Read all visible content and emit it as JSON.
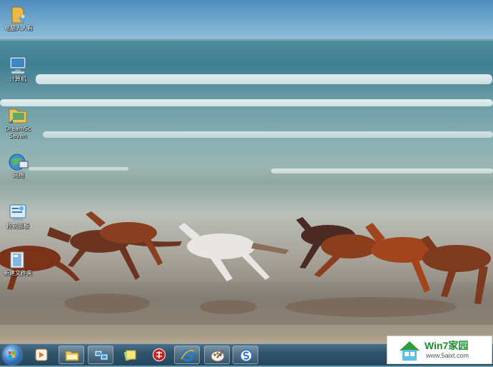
{
  "desktop": {
    "icons": [
      {
        "label": "电脑人人有",
        "icon": "user-folder-icon"
      },
      {
        "label": "计算机",
        "icon": "computer-icon"
      },
      {
        "label": "DreamSc\nSeven",
        "icon": "dreamscene-folder-icon"
      },
      {
        "label": "网络",
        "icon": "network-icon"
      },
      {
        "label": "控制面板",
        "icon": "control-panel-icon"
      },
      {
        "label": "新建文件夹",
        "icon": "new-folder-icon"
      }
    ]
  },
  "taskbar": {
    "start": "windows-orb-icon",
    "buttons": [
      {
        "icon": "media-player-icon"
      },
      {
        "icon": "explorer-folder-icon"
      },
      {
        "icon": "network-center-icon"
      },
      {
        "icon": "sticky-notes-icon"
      },
      {
        "icon": "chinese-chess-icon"
      },
      {
        "icon": "internet-explorer-icon"
      },
      {
        "icon": "paint-icon"
      },
      {
        "icon": "sogou-icon"
      }
    ]
  },
  "watermark": {
    "title": "Win7家园",
    "url": "www.5aixt.com",
    "colors": {
      "title": "#1c8c2c",
      "house": "#2e9c3a"
    }
  }
}
